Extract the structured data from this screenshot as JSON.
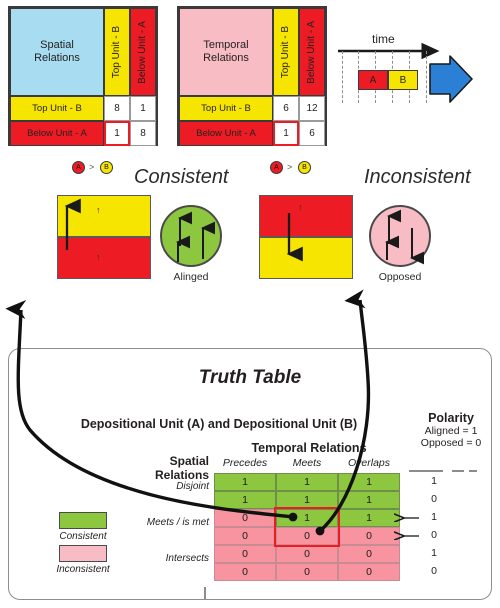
{
  "spatial_matrix": {
    "title": "Spatial\nRelations",
    "title_line1": "Spatial",
    "title_line2": "Relations",
    "col_headers": [
      "Top Unit - B",
      "Below Unit - A"
    ],
    "row_headers": [
      "Top Unit - B",
      "Below Unit - A"
    ],
    "values": [
      [
        "8",
        "1"
      ],
      [
        "1",
        "8"
      ]
    ],
    "highlight": {
      "row": 1,
      "col": 0
    },
    "colors": {
      "title_bg": "#a8dcf0",
      "col1_bg": "#f6e500",
      "col2_bg": "#ed1c24"
    }
  },
  "temporal_matrix": {
    "title_line1": "Temporal",
    "title_line2": "Relations",
    "col_headers": [
      "Top Unit - B",
      "Below Unit - A"
    ],
    "row_headers": [
      "Top Unit - B",
      "Below Unit - A"
    ],
    "values": [
      [
        "6",
        "12"
      ],
      [
        "1",
        "6"
      ]
    ],
    "highlight": {
      "row": 1,
      "col": 0
    },
    "colors": {
      "title_bg": "#f7bcc4",
      "col1_bg": "#f6e500",
      "col2_bg": "#ed1c24"
    }
  },
  "time_diagram": {
    "label": "time",
    "block_a": "A",
    "block_b": "B",
    "colors": {
      "a": "#ed1c24",
      "b": "#f6e500",
      "arrow": "#2b7fd4"
    }
  },
  "consistent_case": {
    "relation": "A > B",
    "unit_a_label": "A",
    "unit_b_label": "B",
    "relation_operator": ">",
    "title": "Consistent",
    "circle_caption": "Alinged",
    "top_block_color": "#f6e500",
    "bottom_block_color": "#ed1c24",
    "circle_color": "#8dc63f",
    "arrow_direction": "up"
  },
  "inconsistent_case": {
    "relation": "A > B",
    "unit_a_label": "A",
    "unit_b_label": "B",
    "relation_operator": ">",
    "title": "Inconsistent",
    "circle_caption": "Opposed",
    "top_block_color": "#ed1c24",
    "bottom_block_color": "#f6e500",
    "circle_color": "#f7bcc4",
    "arrow_direction": "down"
  },
  "truth_table": {
    "title": "Truth Table",
    "subtitle": "Depositional Unit (A) and Depositional Unit (B)",
    "temporal_header": "Temporal Relations",
    "spatial_header_line1": "Spatial",
    "spatial_header_line2": "Relations",
    "columns": [
      "Precedes",
      "Meets",
      "Overlaps"
    ],
    "row_groups": [
      "Disjoint",
      "Meets / is met",
      "Intersects"
    ],
    "rows": [
      {
        "group": "Disjoint",
        "values": [
          "1",
          "1",
          "1"
        ],
        "polarity": "1",
        "consistent": true
      },
      {
        "group": "Disjoint",
        "values": [
          "1",
          "1",
          "1"
        ],
        "polarity": "0",
        "consistent": true
      },
      {
        "group": "Meets / is met",
        "values": [
          "0",
          "1",
          "1"
        ],
        "polarity": "1",
        "consistent": true
      },
      {
        "group": "Meets / is met",
        "values": [
          "0",
          "0",
          "0"
        ],
        "polarity": "0",
        "consistent": false
      },
      {
        "group": "Intersects",
        "values": [
          "0",
          "0",
          "0"
        ],
        "polarity": "1",
        "consistent": false
      },
      {
        "group": "Intersects",
        "values": [
          "0",
          "0",
          "0"
        ],
        "polarity": "0",
        "consistent": false
      }
    ],
    "polarity": {
      "title": "Polarity",
      "aligned": "Aligned = 1",
      "opposed": "Opposed = 0"
    },
    "legend": [
      {
        "label": "Consistent",
        "color": "#8dc63f"
      },
      {
        "label": "Inconsistent",
        "color": "#f7bcc4"
      }
    ],
    "highlight_box": {
      "col": "Meets",
      "rows": [
        2,
        3
      ]
    },
    "colors": {
      "consistent": "#8dc63f",
      "inconsistent": "#f7949f",
      "highlight": "#ed1c24"
    }
  }
}
